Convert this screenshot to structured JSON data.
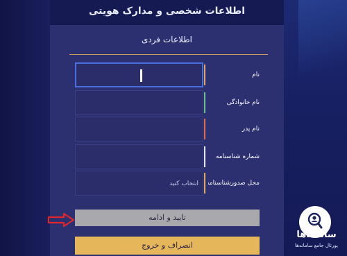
{
  "page": {
    "title": "اطلاعات شخصی و مدارک هویتی",
    "section_title": "اطلاعات فردی"
  },
  "form": {
    "fields": [
      {
        "label": "نام",
        "value": "",
        "accent": "#e0a85a",
        "focused": true
      },
      {
        "label": "نام خانوادگی",
        "value": "",
        "accent": "#6cc08a"
      },
      {
        "label": "نام پدر",
        "value": "",
        "accent": "#e06b4a"
      },
      {
        "label": "شماره شناسنامه",
        "value": "",
        "accent": "#e8e8e8"
      },
      {
        "label": "محل صدورشناسنامه",
        "value": "",
        "placeholder": "انتخاب کنید",
        "accent": "#e0a85a"
      }
    ],
    "confirm_label": "تایید و ادامه",
    "cancel_label": "انصراف و خروج"
  },
  "brand": {
    "name": "سامانه‌ها",
    "tagline": "پورتال جامع سامانه‌ها"
  },
  "colors": {
    "background": "#161a52",
    "panel": "#2d3070",
    "confirm_button": "#a9a9ad",
    "cancel_button": "#e6b75a",
    "arrow": "#e0262a"
  }
}
